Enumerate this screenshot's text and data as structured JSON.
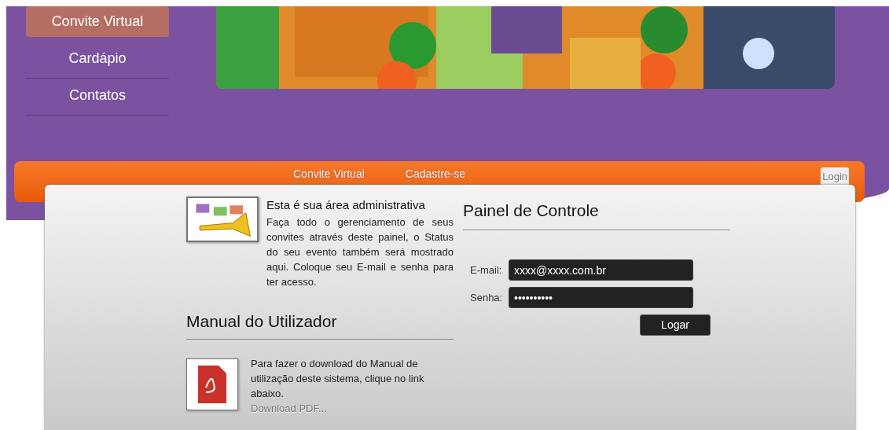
{
  "side_menu": [
    {
      "label": "Convite Virtual",
      "selected": true
    },
    {
      "label": "Cardápio",
      "selected": false
    },
    {
      "label": "Contatos",
      "selected": false
    }
  ],
  "top_bar": {
    "links": [
      "Convite Virtual",
      "Cadastre-se"
    ],
    "login": "Login"
  },
  "intro": {
    "title": "Esta é sua área administrativa",
    "text": "Faça todo o gerenciamento de seus convites através deste painel, o Status do seu evento também será mostrado aqui. Coloque seu E-mail e senha para ter acesso."
  },
  "manual": {
    "title": "Manual do Utilizador",
    "text": "Para fazer o download do Manual de utilização deste sistema, clique no link abaixo.",
    "link": "Download PDF..."
  },
  "login_panel": {
    "title": "Painel de Controle",
    "fields": [
      {
        "label": "E-mail:",
        "value": "xxxx@xxxx.com.br"
      },
      {
        "label": "Senha:",
        "value": "••••••••••"
      }
    ],
    "button": "Logar"
  }
}
